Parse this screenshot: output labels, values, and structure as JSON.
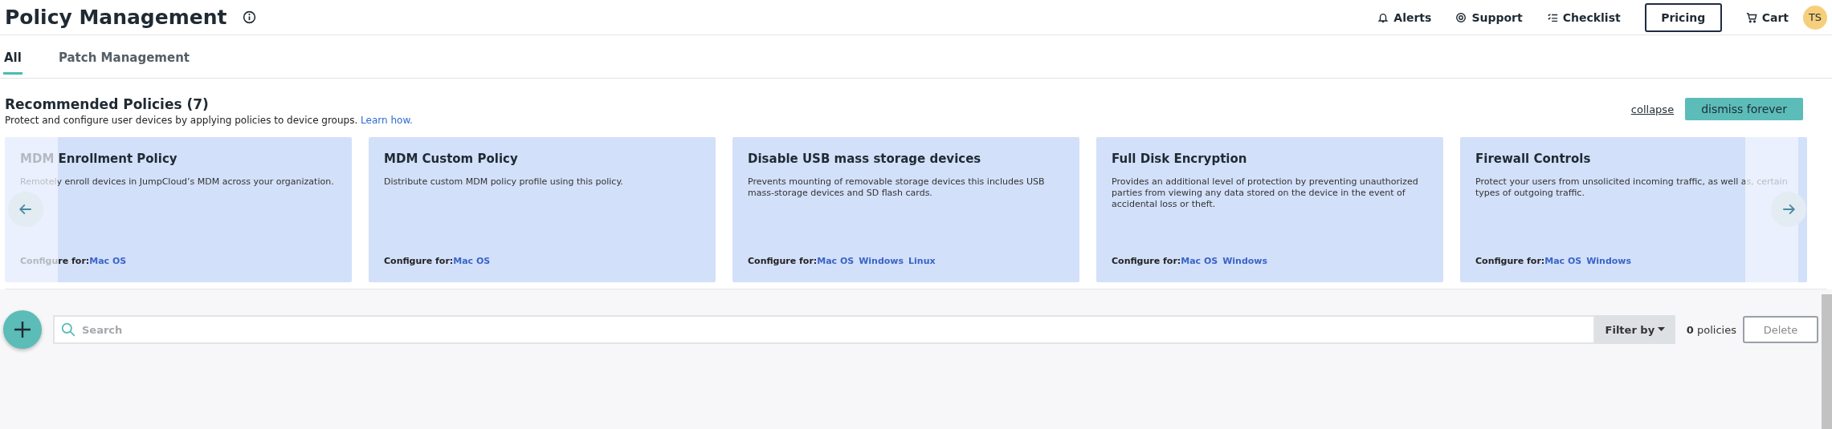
{
  "header": {
    "title": "Policy Management",
    "nav": [
      {
        "kind": "alerts",
        "label": "Alerts"
      },
      {
        "kind": "support",
        "label": "Support"
      },
      {
        "kind": "checklist",
        "label": "Checklist"
      },
      {
        "kind": "pricing",
        "label": "Pricing"
      },
      {
        "kind": "cart",
        "label": "Cart"
      }
    ],
    "avatar": "TS"
  },
  "tabs": [
    {
      "label": "All",
      "selected": true
    },
    {
      "label": "Patch Management",
      "selected": false
    }
  ],
  "recommended": {
    "title": "Recommended Policies (7)",
    "description": "Protect and configure user devices by applying policies to device groups.",
    "learn_link": "Learn how.",
    "collapse": "collapse",
    "dismiss": "dismiss forever",
    "cards": [
      {
        "title": "MDM Enrollment Policy",
        "description": "Remotely enroll devices in JumpCloud’s MDM across your organization.",
        "configure_label": "Configure for:",
        "platforms": [
          "Mac OS"
        ]
      },
      {
        "title": "MDM Custom Policy",
        "description": "Distribute custom MDM policy profile using this policy.",
        "configure_label": "Configure for:",
        "platforms": [
          "Mac OS"
        ]
      },
      {
        "title": "Disable USB mass storage devices",
        "description": "Prevents mounting of removable storage devices this includes USB mass-storage devices and SD flash cards.",
        "configure_label": "Configure for:",
        "platforms": [
          "Mac OS",
          "Windows",
          "Linux"
        ]
      },
      {
        "title": "Full Disk Encryption",
        "description": "Provides an additional level of protection by preventing unauthorized parties from viewing any data stored on the device in the event of accidental loss or theft.",
        "configure_label": "Configure for:",
        "platforms": [
          "Mac OS",
          "Windows"
        ]
      },
      {
        "title": "Firewall Controls",
        "description": "Protect your users from unsolicited incoming traffic, as well as, certain types of outgoing traffic.",
        "configure_label": "Configure for:",
        "platforms": [
          "Mac OS",
          "Windows"
        ]
      }
    ]
  },
  "toolbar": {
    "search": {
      "placeholder": "Search"
    },
    "filter": "Filter by",
    "count": "**0** policies",
    "delete": "Delete"
  }
}
